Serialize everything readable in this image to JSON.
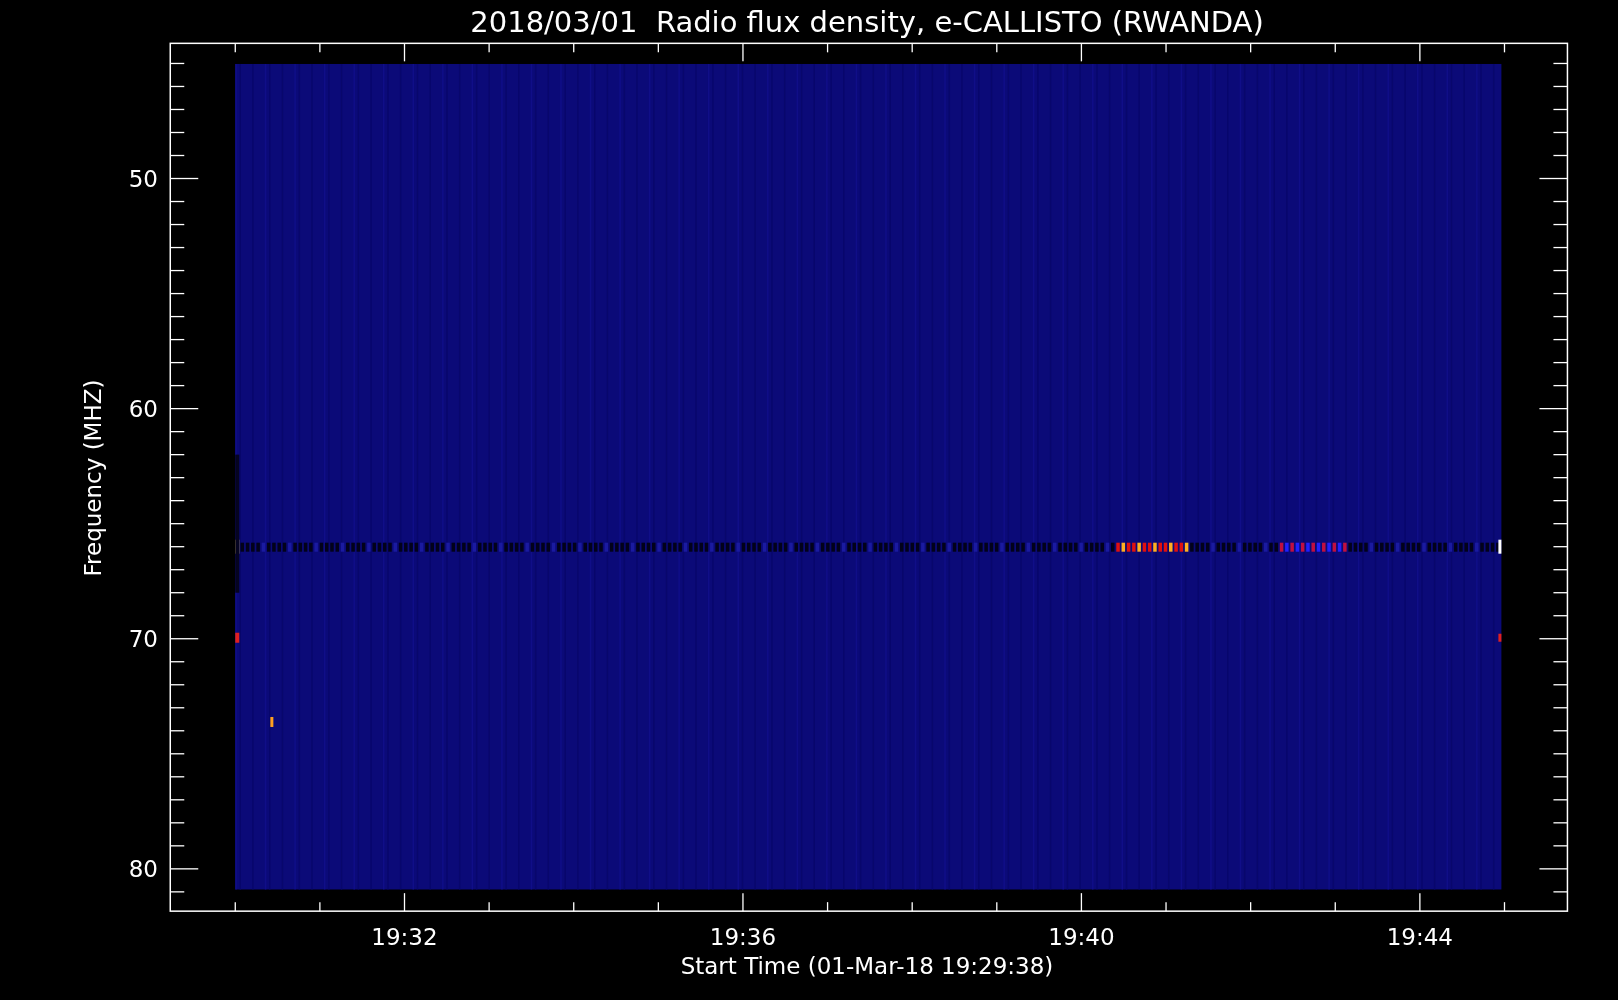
{
  "title": "2018/03/01  Radio flux density, e-CALLISTO (RWANDA)",
  "y_axis": {
    "label": "Frequency (MHZ)",
    "ticks": [
      "50",
      "60",
      "70",
      "80"
    ]
  },
  "x_axis": {
    "label": "Start Time (01-Mar-18 19:29:38)",
    "ticks": [
      "19:32",
      "19:36",
      "19:40",
      "19:44"
    ]
  }
}
